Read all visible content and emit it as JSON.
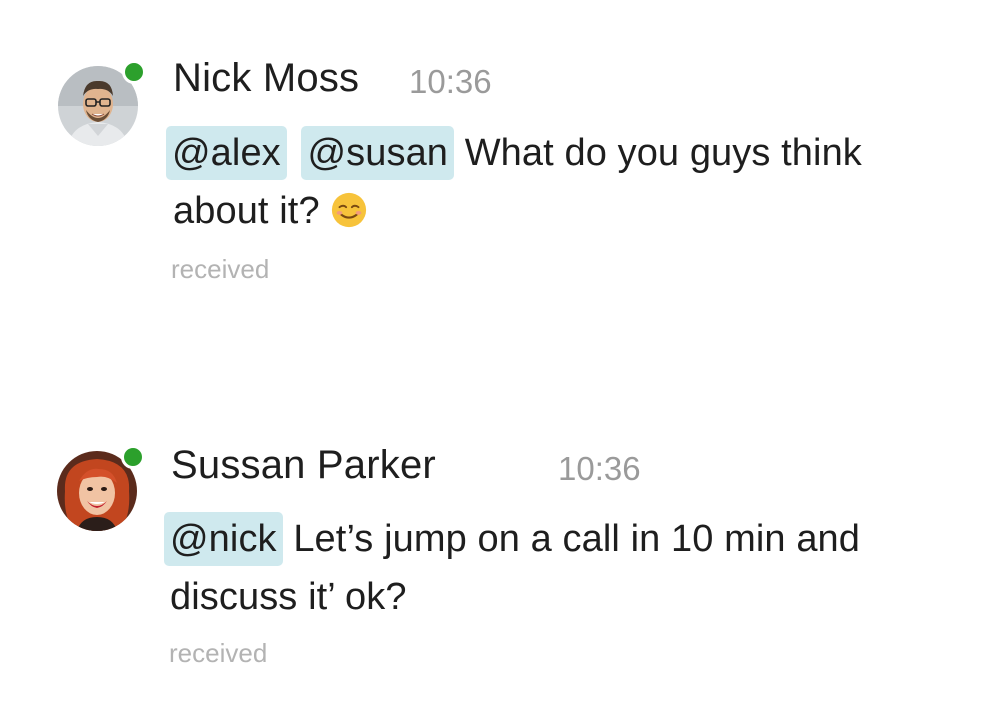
{
  "theme": {
    "presence_color": "#2ca02c",
    "mention_bg": "#cfe9ee",
    "emoji_color": "#f7c33b"
  },
  "messages": [
    {
      "sender": "Nick Moss",
      "time": "10:36",
      "mentions": [
        "@alex",
        "@susan"
      ],
      "text_line1": "What do you guys think",
      "text_line2": "about it?",
      "emoji": "relieved-smile-emoji",
      "status": "received",
      "online": true,
      "avatar": "man-with-glasses-avatar"
    },
    {
      "sender": "Sussan Parker",
      "time": "10:36",
      "mentions": [
        "@nick"
      ],
      "text_line1": "Let’s jump on a call in 10 min and",
      "text_line2": "discuss it’ ok?",
      "status": "received",
      "online": true,
      "avatar": "woman-red-hair-avatar"
    }
  ]
}
